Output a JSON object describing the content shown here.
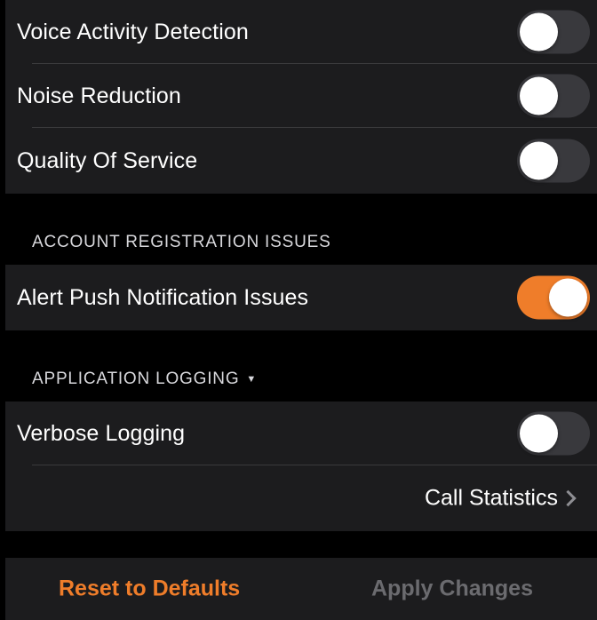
{
  "colors": {
    "accent": "#ef7d2a",
    "background": "#000000",
    "cell": "#1c1c1e",
    "toggle_off": "#39393d",
    "disabled": "#6b6b6f"
  },
  "audio_settings": {
    "items": [
      {
        "label": "Voice Activity Detection",
        "enabled": false
      },
      {
        "label": "Noise Reduction",
        "enabled": false
      },
      {
        "label": "Quality Of Service",
        "enabled": false
      }
    ]
  },
  "account_section": {
    "header": "ACCOUNT REGISTRATION ISSUES",
    "items": [
      {
        "label": "Alert Push Notification Issues",
        "enabled": true
      }
    ]
  },
  "logging_section": {
    "header": "APPLICATION LOGGING",
    "caret_icon": "triangle-down-icon",
    "items": [
      {
        "label": "Verbose Logging",
        "enabled": false
      }
    ],
    "link": {
      "label": "Call Statistics",
      "icon": "chevron-right-icon"
    }
  },
  "footer": {
    "reset_label": "Reset to Defaults",
    "apply_label": "Apply Changes"
  }
}
